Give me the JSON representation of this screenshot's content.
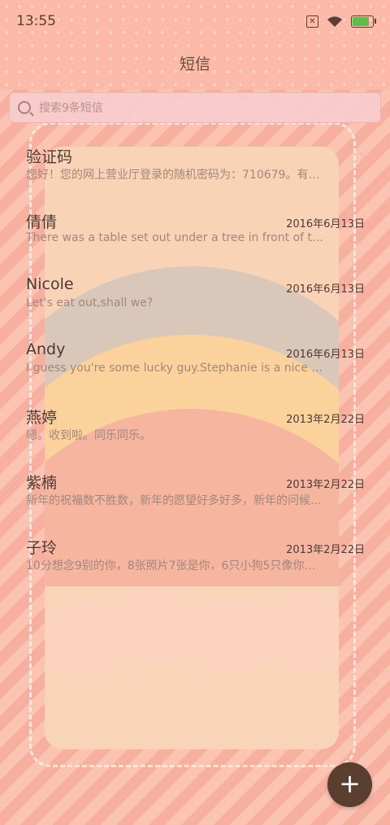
{
  "status_bar": {
    "time": "13:55",
    "icons": [
      "notification-box-icon",
      "wifi-icon",
      "battery-charging-icon"
    ],
    "battery_level": 0.85
  },
  "header": {
    "title": "短信"
  },
  "search": {
    "placeholder": "搜索9条短信"
  },
  "messages": [
    {
      "name": "验证码",
      "date": "",
      "preview": "您好！您的网上营业厅登录的随机密码为：710679。有效..."
    },
    {
      "name": "倩倩",
      "date": "2016年6月13日",
      "preview": "There was a table set out under a tree in front of the h..."
    },
    {
      "name": "Nicole",
      "date": "2016年6月13日",
      "preview": "Let's eat out,shall we?"
    },
    {
      "name": "Andy",
      "date": "2016年6月13日",
      "preview": "I guess you're some lucky guy.Stephanie is a nice girl."
    },
    {
      "name": "燕婷",
      "date": "2013年2月22日",
      "preview": "嗯。收到啦。同乐同乐。"
    },
    {
      "name": "紫楠",
      "date": "2013年2月22日",
      "preview": "新年的祝福数不胜数，新年的愿望好多好多，新年的问候..."
    },
    {
      "name": "子玲",
      "date": "2013年2月22日",
      "preview": "10分想念9别的你，8张照片7张是你，6只小狗5只像你，4..."
    }
  ],
  "fab": {
    "label": "+"
  },
  "colors": {
    "accent": "#5a3f30",
    "text": "#4f3a33",
    "preview": "#a3877c",
    "background": "#f7b0a0"
  }
}
